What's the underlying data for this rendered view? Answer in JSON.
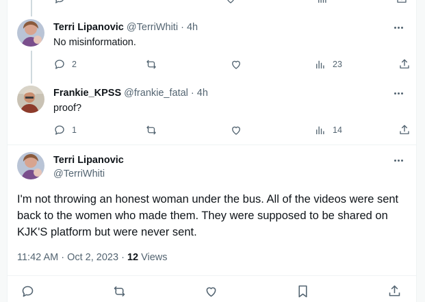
{
  "replies": [
    {
      "name": "Terri Lipanovic",
      "handle": "@TerriWhiti",
      "time": "4h",
      "text": "No misinformation.",
      "stats": {
        "replies": "2",
        "retweets": "",
        "likes": "",
        "views": "23"
      }
    },
    {
      "name": "Frankie_KPSS",
      "handle": "@frankie_fatal",
      "time": "4h",
      "text": "proof?",
      "stats": {
        "replies": "1",
        "retweets": "",
        "likes": "",
        "views": "14"
      }
    }
  ],
  "main_tweet": {
    "name": "Terri Lipanovic",
    "handle": "@TerriWhiti",
    "text": "I'm not throwing an honest woman under the bus. All of the videos were sent back to the women who made them. They were supposed to be shared on KJK'S platform but were never sent.",
    "timestamp": "11:42 AM · Oct 2, 2023 · ",
    "views_count": "12",
    "views_label": " Views"
  },
  "icons": {
    "reply": "reply-icon",
    "retweet": "retweet-icon",
    "like": "heart-icon",
    "views": "views-icon",
    "share": "share-icon",
    "bookmark": "bookmark-icon",
    "more": "more-icon"
  },
  "colors": {
    "text": "#0f1419",
    "secondary": "#536471",
    "thread_line": "#cfd9de"
  }
}
